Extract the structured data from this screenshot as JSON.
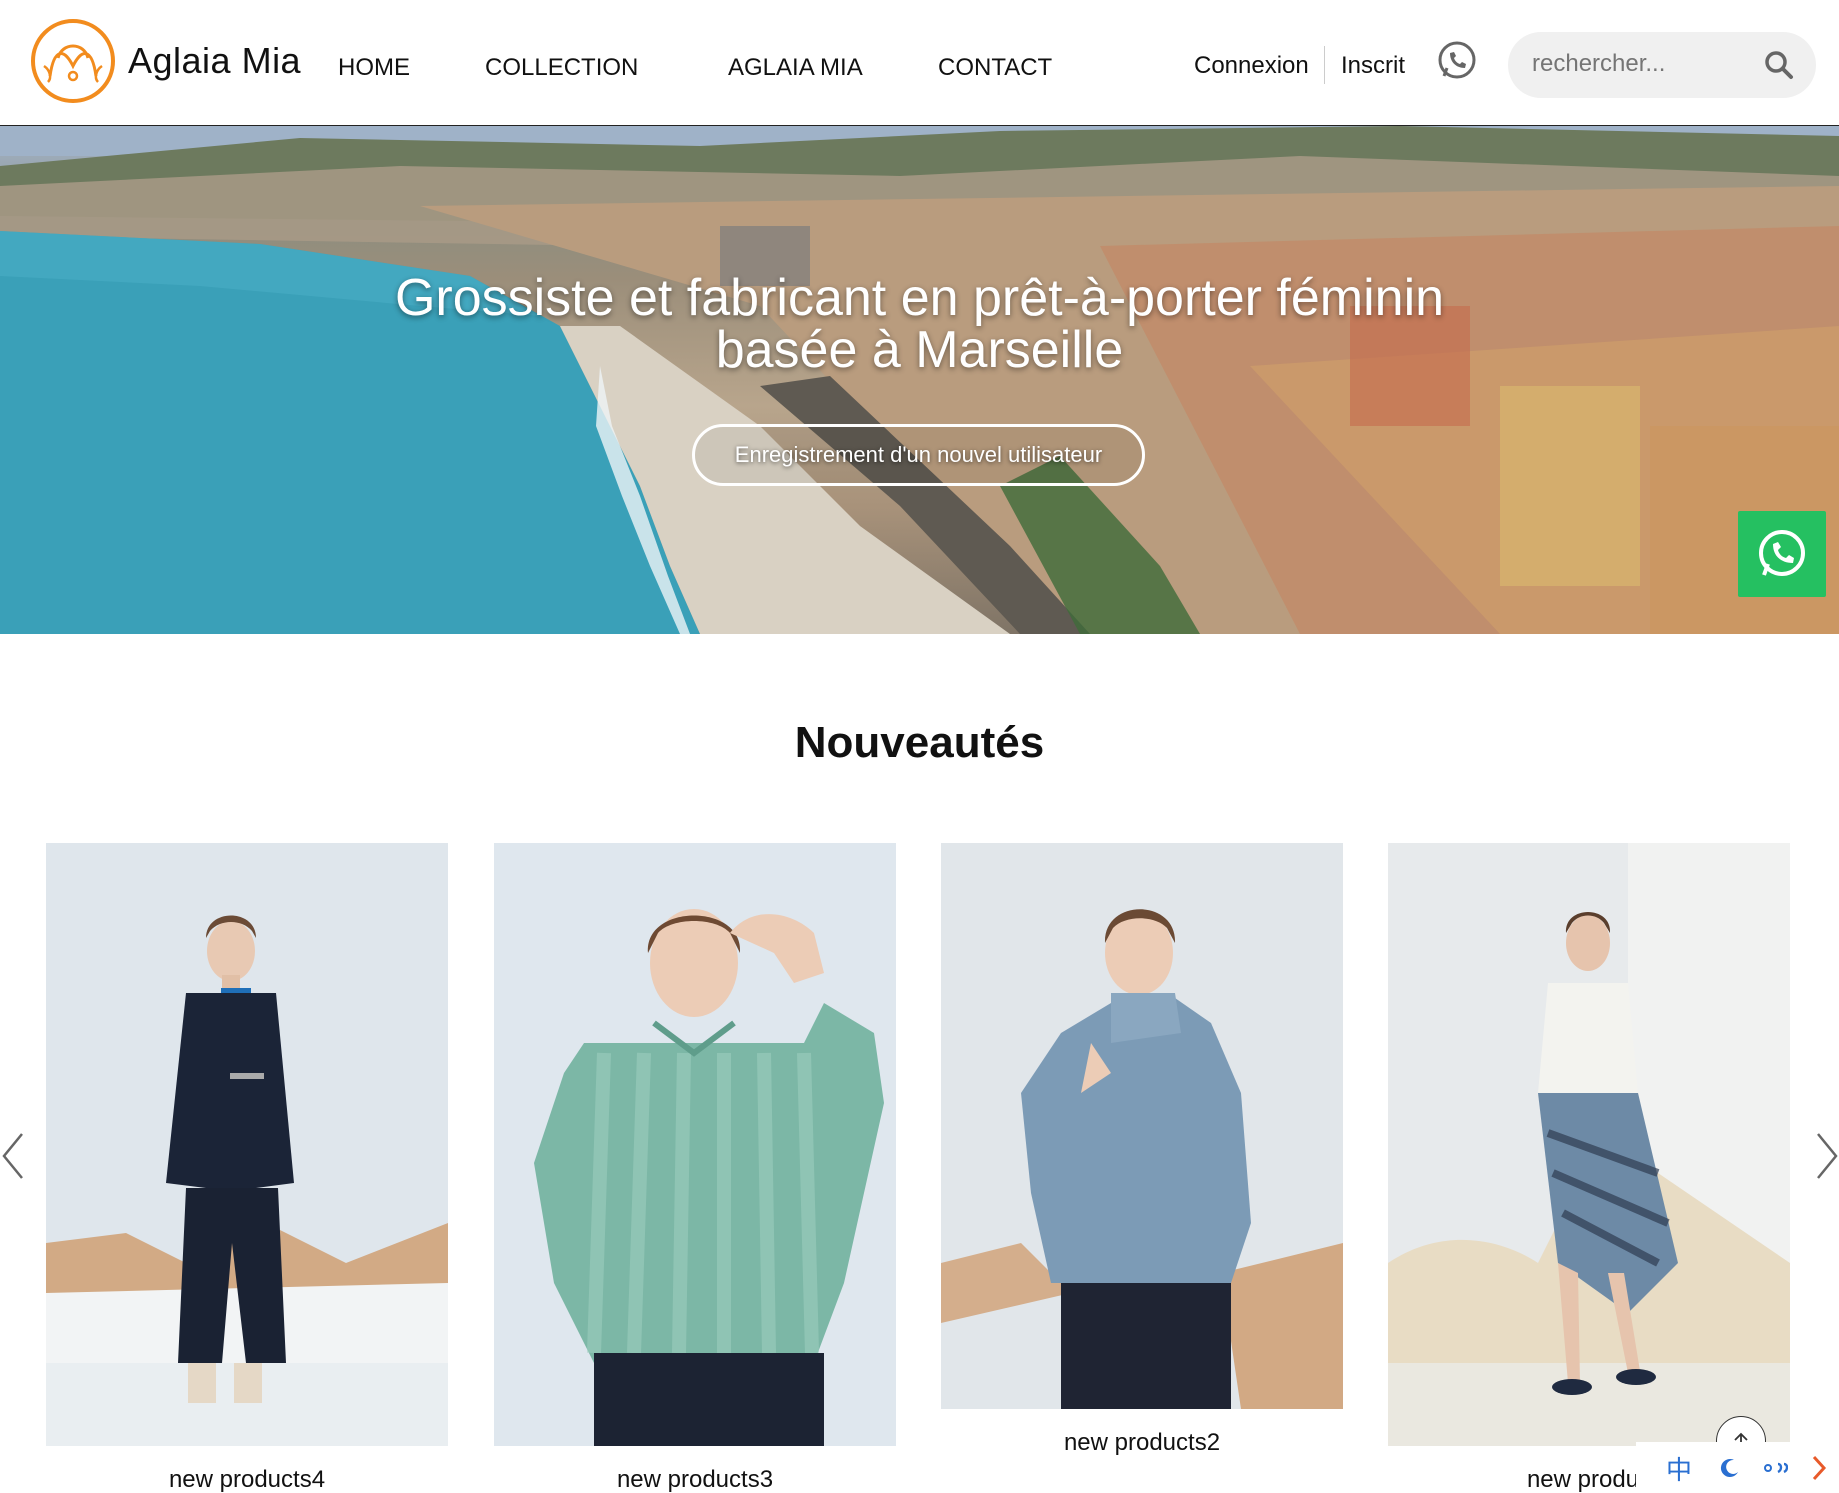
{
  "header": {
    "logo_text": "Aglaia Mia",
    "nav": [
      "HOME",
      "COLLECTION",
      "AGLAIA MIA",
      "CONTACT"
    ],
    "login": "Connexion",
    "register": "Inscrit",
    "search_placeholder": "rechercher..."
  },
  "hero": {
    "title_line1": "Grossiste et fabricant en prêt-à-porter féminin",
    "title_line2": "basée à Marseille",
    "cta": "Enregistrement d'un nouvel utilisateur"
  },
  "products": {
    "title": "Nouveautés",
    "items": [
      {
        "label": "new products4"
      },
      {
        "label": "new products3"
      },
      {
        "label": "new products2"
      },
      {
        "label": "new produc"
      }
    ]
  },
  "tray": {
    "ime": "中"
  },
  "colors": {
    "accent": "#f28c1e",
    "whatsapp": "#25c061",
    "sea": "#3aa0b8"
  }
}
